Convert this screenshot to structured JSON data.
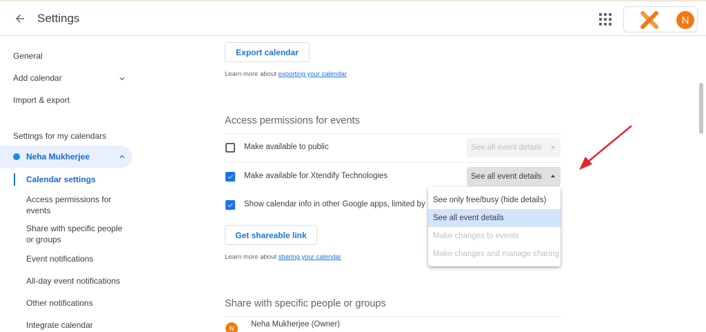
{
  "header": {
    "title": "Settings",
    "account_initial": "N"
  },
  "sidebar": {
    "items": [
      {
        "label": "General"
      },
      {
        "label": "Add calendar"
      },
      {
        "label": "Import & export"
      }
    ],
    "section_label": "Settings for my calendars",
    "calendar_name": "Neha Mukherjee",
    "calendar_color": "#1a8fe0",
    "sub_items": [
      {
        "label": "Calendar settings"
      },
      {
        "label": "Access permissions for events"
      },
      {
        "label": "Share with specific people or groups"
      },
      {
        "label": "Event notifications"
      },
      {
        "label": "All-day event notifications"
      },
      {
        "label": "Other notifications"
      },
      {
        "label": "Integrate calendar"
      }
    ]
  },
  "main": {
    "export_button": "Export calendar",
    "export_learn_prefix": "Learn more about ",
    "export_learn_link": "exporting your calendar",
    "access_title": "Access permissions for events",
    "permissions": [
      {
        "label": "Make available to public",
        "checked": false,
        "select": "See all event details"
      },
      {
        "label": "Make available for Xtendify Technologies",
        "checked": true,
        "select": "See all event details"
      },
      {
        "label": "Show calendar info in other Google apps, limited by ca",
        "checked": true
      }
    ],
    "share_link_button": "Get shareable link",
    "share_learn_prefix": "Learn more about ",
    "share_learn_link": "sharing your calendar",
    "share_title": "Share with specific people or groups",
    "owner_initial": "N",
    "owner_name": "Neha Mukherjee (Owner)"
  },
  "dropdown": {
    "options": [
      {
        "label": "See only free/busy (hide details)",
        "state": "normal"
      },
      {
        "label": "See all event details",
        "state": "selected"
      },
      {
        "label": "Make changes to events",
        "state": "disabled"
      },
      {
        "label": "Make changes and manage sharing",
        "state": "disabled"
      }
    ]
  },
  "colors": {
    "accent": "#1a73e8",
    "avatar": "#f07a12",
    "annotation_arrow": "#e3262b"
  }
}
